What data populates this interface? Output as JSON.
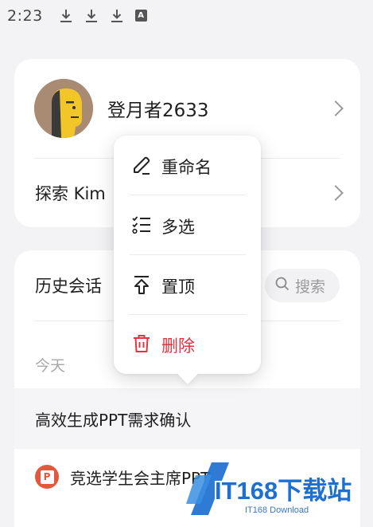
{
  "status_bar": {
    "time": "2:23",
    "icons": [
      "download-icon",
      "download-icon",
      "download-icon",
      "a-box-icon"
    ],
    "a_box_label": "A"
  },
  "profile": {
    "username": "登月者2633",
    "avatar": "avatar-icon"
  },
  "explore": {
    "label": "探索 Kim"
  },
  "history": {
    "title": "历史会话",
    "search_label": "搜索",
    "section_today": "今天",
    "conversations": [
      {
        "title": "高效生成PPT需求确认",
        "icon": null,
        "selected": true
      },
      {
        "title": "竞选学生会主席PPT",
        "icon": "ppt-icon"
      }
    ]
  },
  "context_menu": {
    "items": [
      {
        "label": "重命名",
        "icon": "edit-icon",
        "danger": false
      },
      {
        "label": "多选",
        "icon": "multi-select-icon",
        "danger": false
      },
      {
        "label": "置顶",
        "icon": "pin-top-icon",
        "danger": false
      },
      {
        "label": "删除",
        "icon": "trash-icon",
        "danger": true
      }
    ]
  },
  "watermark": {
    "main": "IT168下载站",
    "sub": "IT168 Download"
  },
  "colors": {
    "background": "#f3f3f5",
    "card": "#ffffff",
    "danger": "#e2343f",
    "muted": "#a8a8a8",
    "avatar_bg": "#a98a72",
    "watermark_blue": "#1d6fd0"
  }
}
